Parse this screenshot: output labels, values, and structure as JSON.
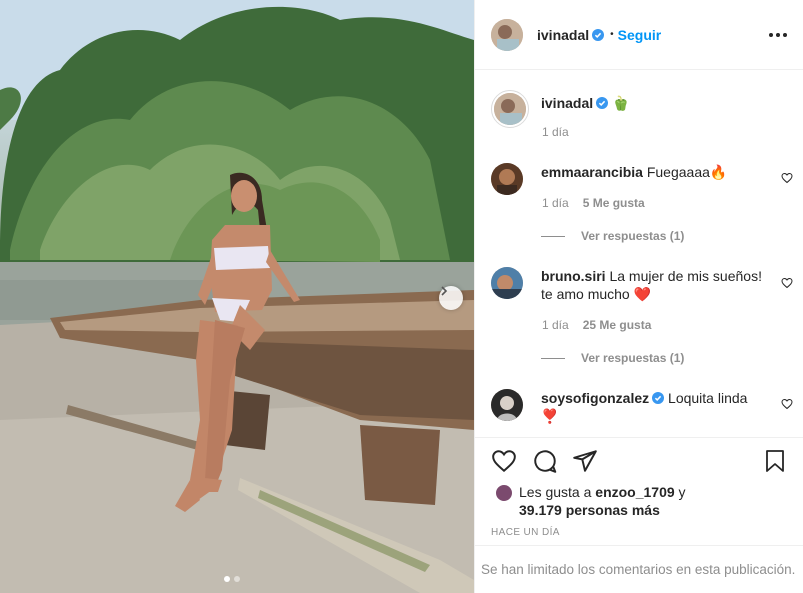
{
  "post": {
    "username": "ivinadal",
    "follow_label": "Seguir",
    "separator": "•",
    "caption_emoji": "🫑",
    "caption_time": "1 día"
  },
  "comments": [
    {
      "user": "emmaarancibia",
      "text": "Fuegaaaa🔥",
      "time": "1 día",
      "likes": "5 Me gusta",
      "replies": "Ver respuestas (1)"
    },
    {
      "user": "bruno.siri",
      "text": "La mujer de mis sueños! te amo mucho ❤️",
      "time": "1 día",
      "likes": "25 Me gusta",
      "replies": "Ver respuestas (1)"
    },
    {
      "user": "soysofigonzalez",
      "text": "Loquita linda",
      "text2": "❣️"
    }
  ],
  "likes": {
    "prefix": "Les gusta a ",
    "user": "enzoo_1709",
    "and": " y",
    "count": "39.179 personas más"
  },
  "timestamp": "HACE UN DÍA",
  "comments_limited": "Se han limitado los comentarios en esta publicación.",
  "carousel": {
    "index": 1,
    "total": 2
  },
  "colors": {
    "accent": "#0095f6",
    "text": "#262626",
    "muted": "#8e8e8e",
    "heart": "#ed4956",
    "verified": "#3897f0"
  }
}
